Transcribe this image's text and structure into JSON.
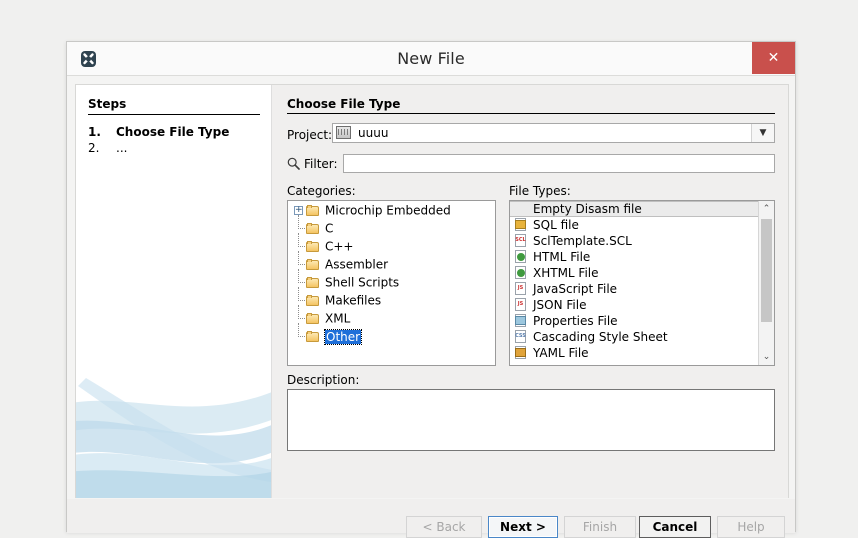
{
  "window": {
    "title": "New File",
    "app_icon": "app-x-icon",
    "close_label": "✕"
  },
  "steps": {
    "heading": "Steps",
    "items": [
      {
        "num": "1.",
        "label": "Choose File Type"
      },
      {
        "num": "2.",
        "label": "..."
      }
    ]
  },
  "content": {
    "heading": "Choose File Type",
    "project": {
      "label": "Project:",
      "value": "uuuu",
      "arrow": "▼"
    },
    "filter": {
      "label": "Filter:",
      "value": "",
      "placeholder": "",
      "icon": "search-icon"
    },
    "categories": {
      "label": "Categories:",
      "items": [
        {
          "label": "Microchip Embedded",
          "expandable": true,
          "expand_glyph": "+",
          "selected": false
        },
        {
          "label": "C",
          "expandable": false,
          "selected": false
        },
        {
          "label": "C++",
          "expandable": false,
          "selected": false
        },
        {
          "label": "Assembler",
          "expandable": false,
          "selected": false
        },
        {
          "label": "Shell Scripts",
          "expandable": false,
          "selected": false
        },
        {
          "label": "Makefiles",
          "expandable": false,
          "selected": false
        },
        {
          "label": "XML",
          "expandable": false,
          "selected": false
        },
        {
          "label": "Other",
          "expandable": false,
          "selected": true
        }
      ]
    },
    "file_types": {
      "label": "File Types:",
      "items": [
        {
          "label": "Empty Disasm file",
          "icon": "none",
          "selected": true
        },
        {
          "label": "SQL file",
          "icon": "sql-file-icon",
          "tag": "",
          "color": "#e8b33c"
        },
        {
          "label": "SclTemplate.SCL",
          "icon": "scl-file-icon",
          "tag": "SCL",
          "color": "#cc3333"
        },
        {
          "label": "HTML File",
          "icon": "html-file-icon",
          "tag": "",
          "color": "#3f9a3f"
        },
        {
          "label": "XHTML File",
          "icon": "xhtml-file-icon",
          "tag": "",
          "color": "#3f9a3f"
        },
        {
          "label": "JavaScript File",
          "icon": "javascript-file-icon",
          "tag": "JS",
          "color": "#cc3333"
        },
        {
          "label": "JSON File",
          "icon": "json-file-icon",
          "tag": "JS",
          "color": "#cc3333"
        },
        {
          "label": "Properties File",
          "icon": "properties-file-icon",
          "tag": "",
          "color": "#5aa0c8"
        },
        {
          "label": "Cascading Style Sheet",
          "icon": "css-file-icon",
          "tag": "",
          "color": "#5a7fae"
        },
        {
          "label": "YAML File",
          "icon": "yaml-file-icon",
          "tag": "",
          "color": "#c98a2e"
        }
      ],
      "scrollbar": {
        "up": "⌃",
        "down": "⌄"
      }
    },
    "description": {
      "label": "Description:",
      "value": ""
    }
  },
  "buttons": [
    {
      "id": "back",
      "label": "< Back",
      "state": "disabled"
    },
    {
      "id": "next",
      "label": "Next >",
      "state": "default"
    },
    {
      "id": "finish",
      "label": "Finish",
      "state": "disabled"
    },
    {
      "id": "cancel",
      "label": "Cancel",
      "state": "strong"
    },
    {
      "id": "help",
      "label": "Help",
      "state": "disabled"
    }
  ],
  "colors": {
    "accent_selected": "#1e6fd9",
    "close_red": "#c9504c",
    "dialog_bg": "#f0efee",
    "swoosh_blue": "#b9d9e8"
  }
}
